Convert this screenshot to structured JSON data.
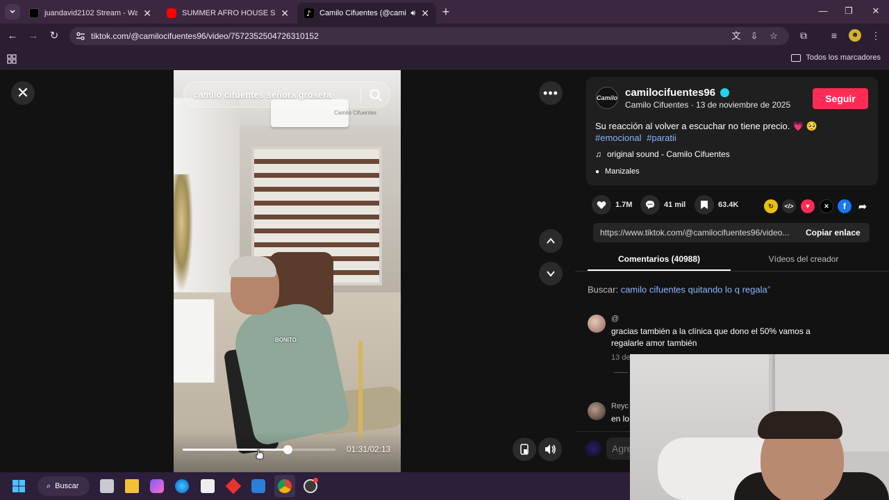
{
  "browser": {
    "tabs": [
      {
        "label": "juandavid2102 Stream - Watch",
        "active": false
      },
      {
        "label": "SUMMER AFRO HOUSE Sunset",
        "active": false
      },
      {
        "label": "Camilo Cifuentes (@camilo",
        "active": true
      }
    ],
    "url": "tiktok.com/@camilocifuentes96/video/7572352504726310152",
    "bookmarks_all": "Todos los marcadores"
  },
  "video": {
    "search_text": "camilo cifuentes señora grosera",
    "watermark": "Camilo Cifuentes",
    "sticker": "BONITO",
    "time": "01:31/02:13",
    "progress": 0.685
  },
  "creator": {
    "username": "camilocifuentes96",
    "meta": "Camilo Cifuentes · 13 de noviembre de 2025",
    "follow_label": "Seguir",
    "description": "Su reacción al volver a escuchar no tiene precio. 💗 🥺",
    "hashtags": [
      "#emocional",
      "#paratii"
    ],
    "music": "original sound - Camilo Cifuentes",
    "location": "Manizales",
    "avatar_text": "Camilo"
  },
  "actions": {
    "likes": "1.7M",
    "comments": "41 mil",
    "saves": "63.4K"
  },
  "share": {
    "link": "https://www.tiktok.com/@camilocifuentes96/video...",
    "copy_label": "Copiar enlace"
  },
  "panel_tabs": {
    "comments": "Comentarios (40988)",
    "creator_videos": "Vídeos del creador"
  },
  "search_suggestion": {
    "prefix": "Buscar:",
    "query": "camilo cifuentes quitando lo q regala"
  },
  "comments": [
    {
      "name": "@",
      "text": "gracias también a la clínica que dono el 50% vamos a regalarle amor también",
      "date": "13 de"
    },
    {
      "name": "Reyc",
      "text": "en lo",
      "date": ""
    }
  ],
  "comment_input": {
    "placeholder": "Agre"
  },
  "taskbar": {
    "search_label": "Buscar"
  },
  "colors": {
    "accent": "#fe2c55",
    "link": "#8cb4ff",
    "tab_bg": "#3b2840"
  }
}
